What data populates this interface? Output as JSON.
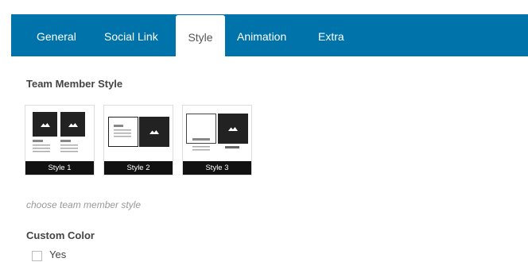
{
  "tabs": [
    {
      "label": "General"
    },
    {
      "label": "Social Link"
    },
    {
      "label": "Style",
      "active": true
    },
    {
      "label": "Animation"
    },
    {
      "label": "Extra"
    }
  ],
  "team_member_style": {
    "label": "Team Member Style",
    "options": [
      {
        "caption": "Style 1"
      },
      {
        "caption": "Style 2"
      },
      {
        "caption": "Style 3"
      }
    ],
    "hint": "choose team member style"
  },
  "custom_color": {
    "label": "Custom Color",
    "checkbox_label": "Yes",
    "checked": false
  },
  "colors": {
    "tab_bar": "#0073aa",
    "tab_text": "#ffffff",
    "active_tab_text": "#555555",
    "card_dark": "#222222"
  },
  "icons": [
    "image-placeholder-icon"
  ]
}
